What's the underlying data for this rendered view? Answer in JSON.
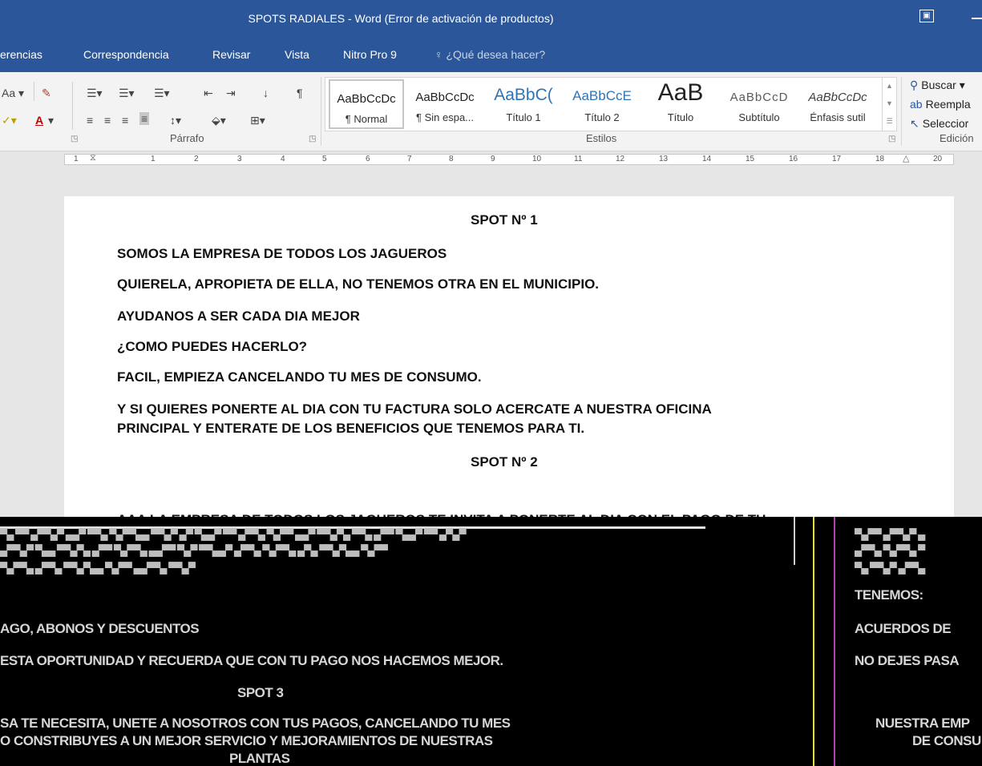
{
  "window": {
    "title": "SPOTS RADIALES - Word (Error de activación de productos)"
  },
  "tabs": [
    {
      "label": "erencias"
    },
    {
      "label": "Correspondencia"
    },
    {
      "label": "Revisar"
    },
    {
      "label": "Vista"
    },
    {
      "label": "Nitro Pro 9"
    },
    {
      "label": "¿Qué desea hacer?"
    }
  ],
  "ribbon": {
    "groups": {
      "paragraph": "Párrafo",
      "styles": "Estilos",
      "editing": "Edición"
    },
    "styles": [
      {
        "preview": "AaBbCcDc",
        "name": "¶ Normal"
      },
      {
        "preview": "AaBbCcDc",
        "name": "¶ Sin espa..."
      },
      {
        "preview": "AaBbC(",
        "name": "Título 1"
      },
      {
        "preview": "AaBbCcE",
        "name": "Título 2"
      },
      {
        "preview": "AaB",
        "name": "Título"
      },
      {
        "preview": "AaBbCcD",
        "name": "Subtítulo"
      },
      {
        "preview": "AaBbCcDc",
        "name": "Énfasis sutil"
      }
    ],
    "editing": {
      "find": "Buscar",
      "replace": "Reempla",
      "select": "Seleccior"
    },
    "font_case": "Aa",
    "pilcrow": "¶"
  },
  "ruler": {
    "numbers": [
      "1",
      "1",
      "2",
      "3",
      "4",
      "5",
      "6",
      "7",
      "8",
      "9",
      "10",
      "11",
      "12",
      "13",
      "14",
      "15",
      "16",
      "17",
      "18",
      "20"
    ]
  },
  "document": {
    "lines": [
      "SPOT Nº 1",
      "SOMOS LA EMPRESA DE TODOS LOS JAGUEROS",
      "QUIERELA, APROPIETA DE ELLA, NO TENEMOS OTRA EN EL MUNICIPIO.",
      "AYUDANOS A SER CADA DIA MEJOR",
      "¿COMO PUEDES HACERLO?",
      "FACIL, EMPIEZA CANCELANDO TU MES DE CONSUMO.",
      "Y SI QUIERES PONERTE AL DIA CON TU FACTURA SOLO ACERCATE A NUESTRA OFICINA",
      "PRINCIPAL Y ENTERATE DE LOS BENEFICIOS QUE TENEMOS PARA TI.",
      "SPOT Nº 2",
      "AAA LA EMPRESA DE TODOS LOS JAGUEROS TE INVITA A PONERTE AL DIA CON EL PAGO DE TU"
    ]
  },
  "glitch_text": {
    "left": [
      "AGO, ABONOS Y DESCUENTOS",
      "ESTA OPORTUNIDAD Y RECUERDA QUE CON TU PAGO NOS HACEMOS MEJOR.",
      "SPOT 3",
      "SA TE NECESITA, UNETE A NOSOTROS CON TUS PAGOS, CANCELANDO TU MES",
      "O CONSTRIBUYES A UN MEJOR SERVICIO Y MEJORAMIENTOS DE NUESTRAS",
      "PLANTAS"
    ],
    "right": [
      "TENEMOS:",
      "ACUERDOS DE",
      "NO DEJES PASA",
      "NUESTRA EMP",
      "DE CONSU"
    ]
  }
}
